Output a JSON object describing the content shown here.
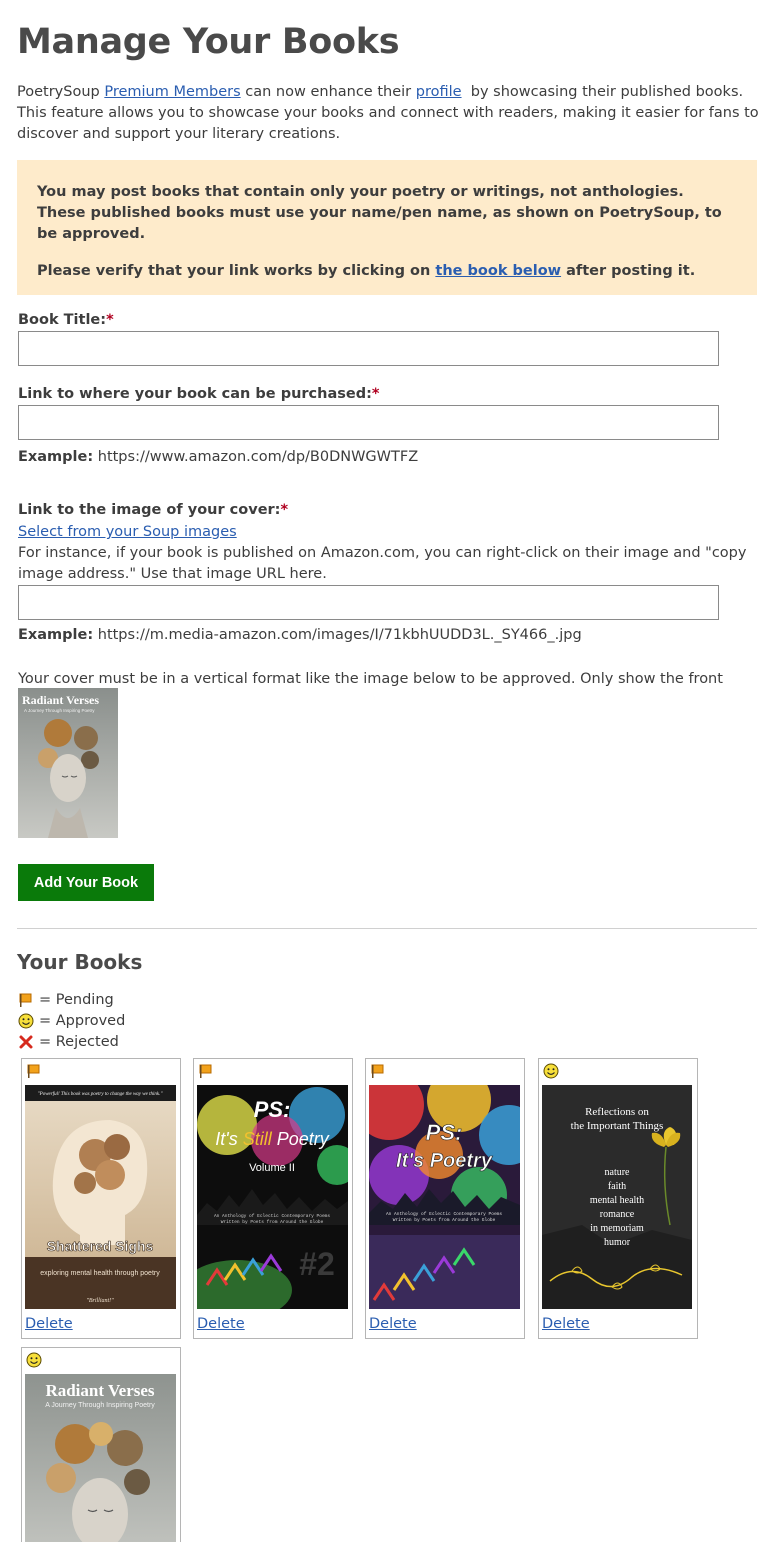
{
  "page": {
    "title": "Manage Your Books",
    "intro": {
      "part1": "PoetrySoup ",
      "premium_link": "Premium Members",
      "part2": " can now enhance their ",
      "profile_link": "profile",
      "part3": "  by showcasing their published books. This feature allows you to showcase your books and connect with readers, making it easier for fans to discover and support your literary creations."
    },
    "notice": {
      "line1": "You may post books that contain only your poetry or writings, not anthologies. These published books must use your name/pen name, as shown on PoetrySoup, to be approved.",
      "line2_part1": "Please verify that your link works by clicking on ",
      "line2_link": "the book below",
      "line2_part2": " after posting it."
    }
  },
  "form": {
    "title_label": "Book Title:",
    "purchase_label": "Link to where your book can be purchased:",
    "required_mark": "*",
    "example_label": "Example:",
    "purchase_example": "https://www.amazon.com/dp/B0DNWGWTFZ",
    "cover_label": "Link to the image of your cover:",
    "select_images_link": "Select from your Soup images",
    "cover_help": "For instance, if your book is published on Amazon.com, you can right-click on their image and \"copy image address.\" Use that image URL here.",
    "cover_example": "https://m.media-amazon.com/images/I/71kbhUUDD3L._SY466_.jpg",
    "vertical_note": "Your cover must be in a vertical format like the image below to be approved. Only show the front cover!",
    "sample_cover": {
      "title": "Radiant Verses",
      "subtitle": "A Journey Through Inspiring Poetry"
    },
    "submit_label": "Add Your Book"
  },
  "your_books": {
    "heading": "Your Books",
    "legend": [
      {
        "icon": "flag-icon",
        "text": "= Pending"
      },
      {
        "icon": "smile-icon",
        "text": "= Approved"
      },
      {
        "icon": "x-icon",
        "text": "= Rejected"
      }
    ],
    "delete_label": "Delete",
    "books": [
      {
        "status": "pending",
        "title": "Shattered Sighs",
        "subtitle": "exploring mental health through poetry",
        "quote": "\"Powerful! This book was poetry to change the way we think.\"",
        "footer": "\"Brilliant!\""
      },
      {
        "status": "pending",
        "title_line1": "PS:",
        "title_line2a": "It's ",
        "title_line2b": "Still",
        "title_line2c": " Poetry",
        "volume": "Volume II",
        "blurb1": "An Anthology of Eclectic Contemporary Poems",
        "blurb2": "Written by Poets from Around the Globe",
        "number": "#2"
      },
      {
        "status": "pending",
        "title_line1": "PS:",
        "title_line2": "It's Poetry",
        "blurb1": "An Anthology of Eclectic Contemporary Poems",
        "blurb2": "Written by Poets from Around the Globe"
      },
      {
        "status": "approved",
        "title_line1": "Reflections on",
        "title_line2": "the Important Things",
        "topics": [
          "nature",
          "faith",
          "mental health",
          "romance",
          "in memoriam",
          "humor"
        ]
      },
      {
        "status": "approved",
        "title": "Radiant Verses",
        "subtitle": "A Journey Through Inspiring Poetry"
      }
    ]
  },
  "colors": {
    "notice_bg": "#feebcb",
    "button_bg": "#0a7a0a",
    "link": "#2a5db0",
    "required": "#b00020"
  }
}
